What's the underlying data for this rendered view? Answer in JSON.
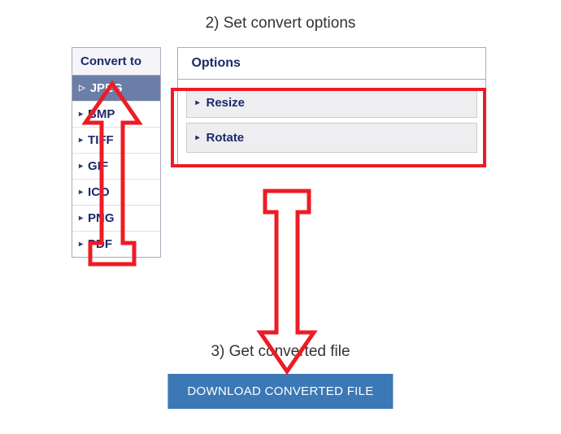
{
  "step2_title": "2) Set convert options",
  "step3_title": "3) Get converted file",
  "sidebar": {
    "header": "Convert to",
    "items": [
      {
        "label": "JPEG",
        "selected": true
      },
      {
        "label": "BMP",
        "selected": false
      },
      {
        "label": "TIFF",
        "selected": false
      },
      {
        "label": "GIF",
        "selected": false
      },
      {
        "label": "ICO",
        "selected": false
      },
      {
        "label": "PNG",
        "selected": false
      },
      {
        "label": "PDF",
        "selected": false
      }
    ]
  },
  "options": {
    "header": "Options",
    "items": [
      {
        "label": "Resize"
      },
      {
        "label": "Rotate"
      }
    ]
  },
  "download_button": "DOWNLOAD CONVERTED FILE",
  "colors": {
    "annotation_red": "#ed1c24",
    "primary_blue": "#3b78b5",
    "text_navy": "#1b2a6b",
    "selected_bg": "#6b7ea8"
  }
}
